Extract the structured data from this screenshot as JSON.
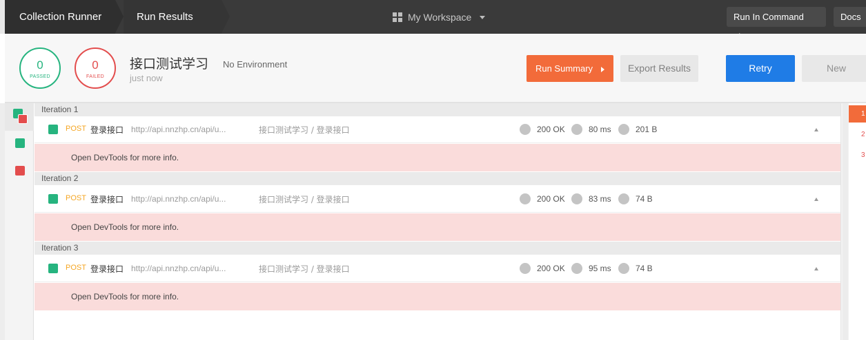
{
  "topbar": {
    "crumb_runner": "Collection Runner",
    "crumb_results": "Run Results",
    "workspace": "My Workspace",
    "cmdline_button": "Run In Command Line",
    "docs_button": "Docs"
  },
  "summary": {
    "passed_count": "0",
    "passed_label": "PASSED",
    "failed_count": "0",
    "failed_label": "FAILED",
    "collection_name": "接口测试学习",
    "environment": "No Environment",
    "time": "just now",
    "run_summary_button": "Run Summary",
    "export_button": "Export Results",
    "retry_button": "Retry",
    "new_button": "New"
  },
  "iterations": [
    {
      "label": "Iteration 1",
      "request": {
        "method": "POST",
        "name": "登录接口",
        "url": "http://api.nnzhp.cn/api/u...",
        "path": "接口测试学习 / 登录接口",
        "status": "200 OK",
        "time": "80 ms",
        "size": "201 B"
      },
      "error": "Open DevTools for more info."
    },
    {
      "label": "Iteration 2",
      "request": {
        "method": "POST",
        "name": "登录接口",
        "url": "http://api.nnzhp.cn/api/u...",
        "path": "接口测试学习 / 登录接口",
        "status": "200 OK",
        "time": "83 ms",
        "size": "74 B"
      },
      "error": "Open DevTools for more info."
    },
    {
      "label": "Iteration 3",
      "request": {
        "method": "POST",
        "name": "登录接口",
        "url": "http://api.nnzhp.cn/api/u...",
        "path": "接口测试学习 / 登录接口",
        "status": "200 OK",
        "time": "95 ms",
        "size": "74 B"
      },
      "error": "Open DevTools for more info."
    }
  ],
  "right_iterations": [
    "1",
    "2",
    "3"
  ],
  "colors": {
    "pass": "#26b47f",
    "fail": "#e34d4d",
    "accent": "#f26b3a",
    "primary": "#1f7ce6"
  }
}
